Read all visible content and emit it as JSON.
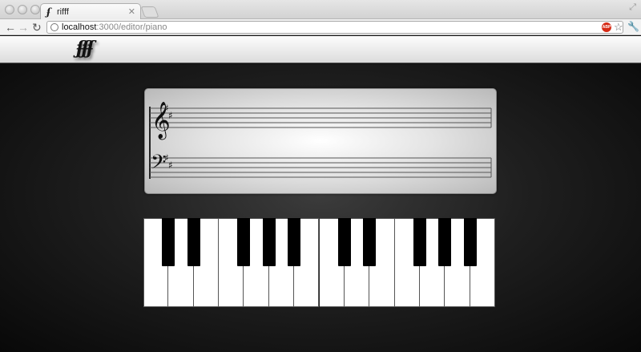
{
  "browser": {
    "tab_title": "rifff",
    "tab_favicon": "ʄ",
    "tab_close_icon": "close-icon",
    "url_host": "localhost",
    "url_rest": ":3000/editor/piano",
    "adblock_label": "ABP"
  },
  "app": {
    "logo_text": "ʄʄʄ"
  },
  "staff": {
    "treble_clef": "𝄞",
    "bass_clef": "𝄢",
    "key_signature": "sharps-2"
  },
  "piano": {
    "white_key_count": 14,
    "black_key_count": 10
  },
  "colors": {
    "background": "#111111",
    "staff_panel": "#e4e4e4",
    "key_white": "#ffffff",
    "key_black": "#000000"
  }
}
